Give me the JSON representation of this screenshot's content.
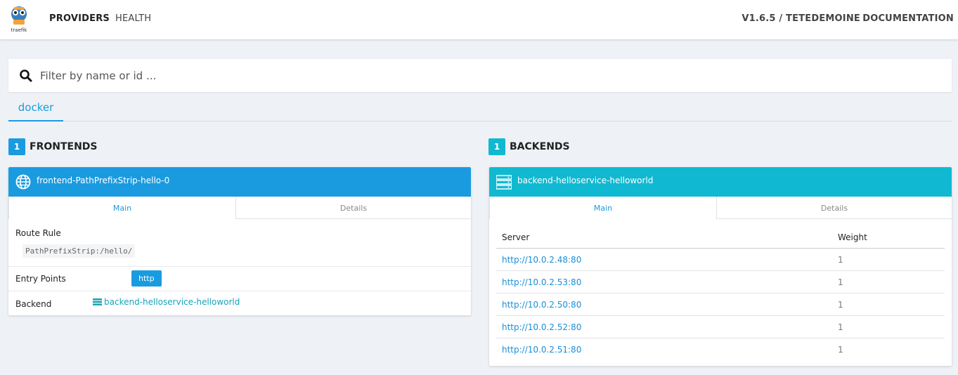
{
  "nav": {
    "logo_text": "traefik",
    "providers": "PROVIDERS",
    "health": "HEALTH",
    "version": "V1.6.5 / TETEDEMOINE",
    "documentation": "DOCUMENTATION"
  },
  "search": {
    "placeholder": "Filter by name or id ...",
    "value": ""
  },
  "provider_tabs": [
    {
      "label": "docker",
      "active": true
    }
  ],
  "frontends": {
    "count": "1",
    "title": "FRONTENDS",
    "color": "#1a9be0",
    "card": {
      "name": "frontend-PathPrefixStrip-hello-0",
      "tabs": {
        "main": "Main",
        "details": "Details"
      },
      "route_rule_label": "Route Rule",
      "route_rule": "PathPrefixStrip:/hello/",
      "entry_points_label": "Entry Points",
      "entry_point": "http",
      "backend_label": "Backend",
      "backend": "backend-helloservice-helloworld"
    }
  },
  "backends": {
    "count": "1",
    "title": "BACKENDS",
    "color": "#10b9d1",
    "card": {
      "name": "backend-helloservice-helloworld",
      "tabs": {
        "main": "Main",
        "details": "Details"
      },
      "columns": {
        "server": "Server",
        "weight": "Weight"
      },
      "servers": [
        {
          "url": "http://10.0.2.48:80",
          "weight": "1"
        },
        {
          "url": "http://10.0.2.53:80",
          "weight": "1"
        },
        {
          "url": "http://10.0.2.50:80",
          "weight": "1"
        },
        {
          "url": "http://10.0.2.52:80",
          "weight": "1"
        },
        {
          "url": "http://10.0.2.51:80",
          "weight": "1"
        }
      ]
    }
  }
}
